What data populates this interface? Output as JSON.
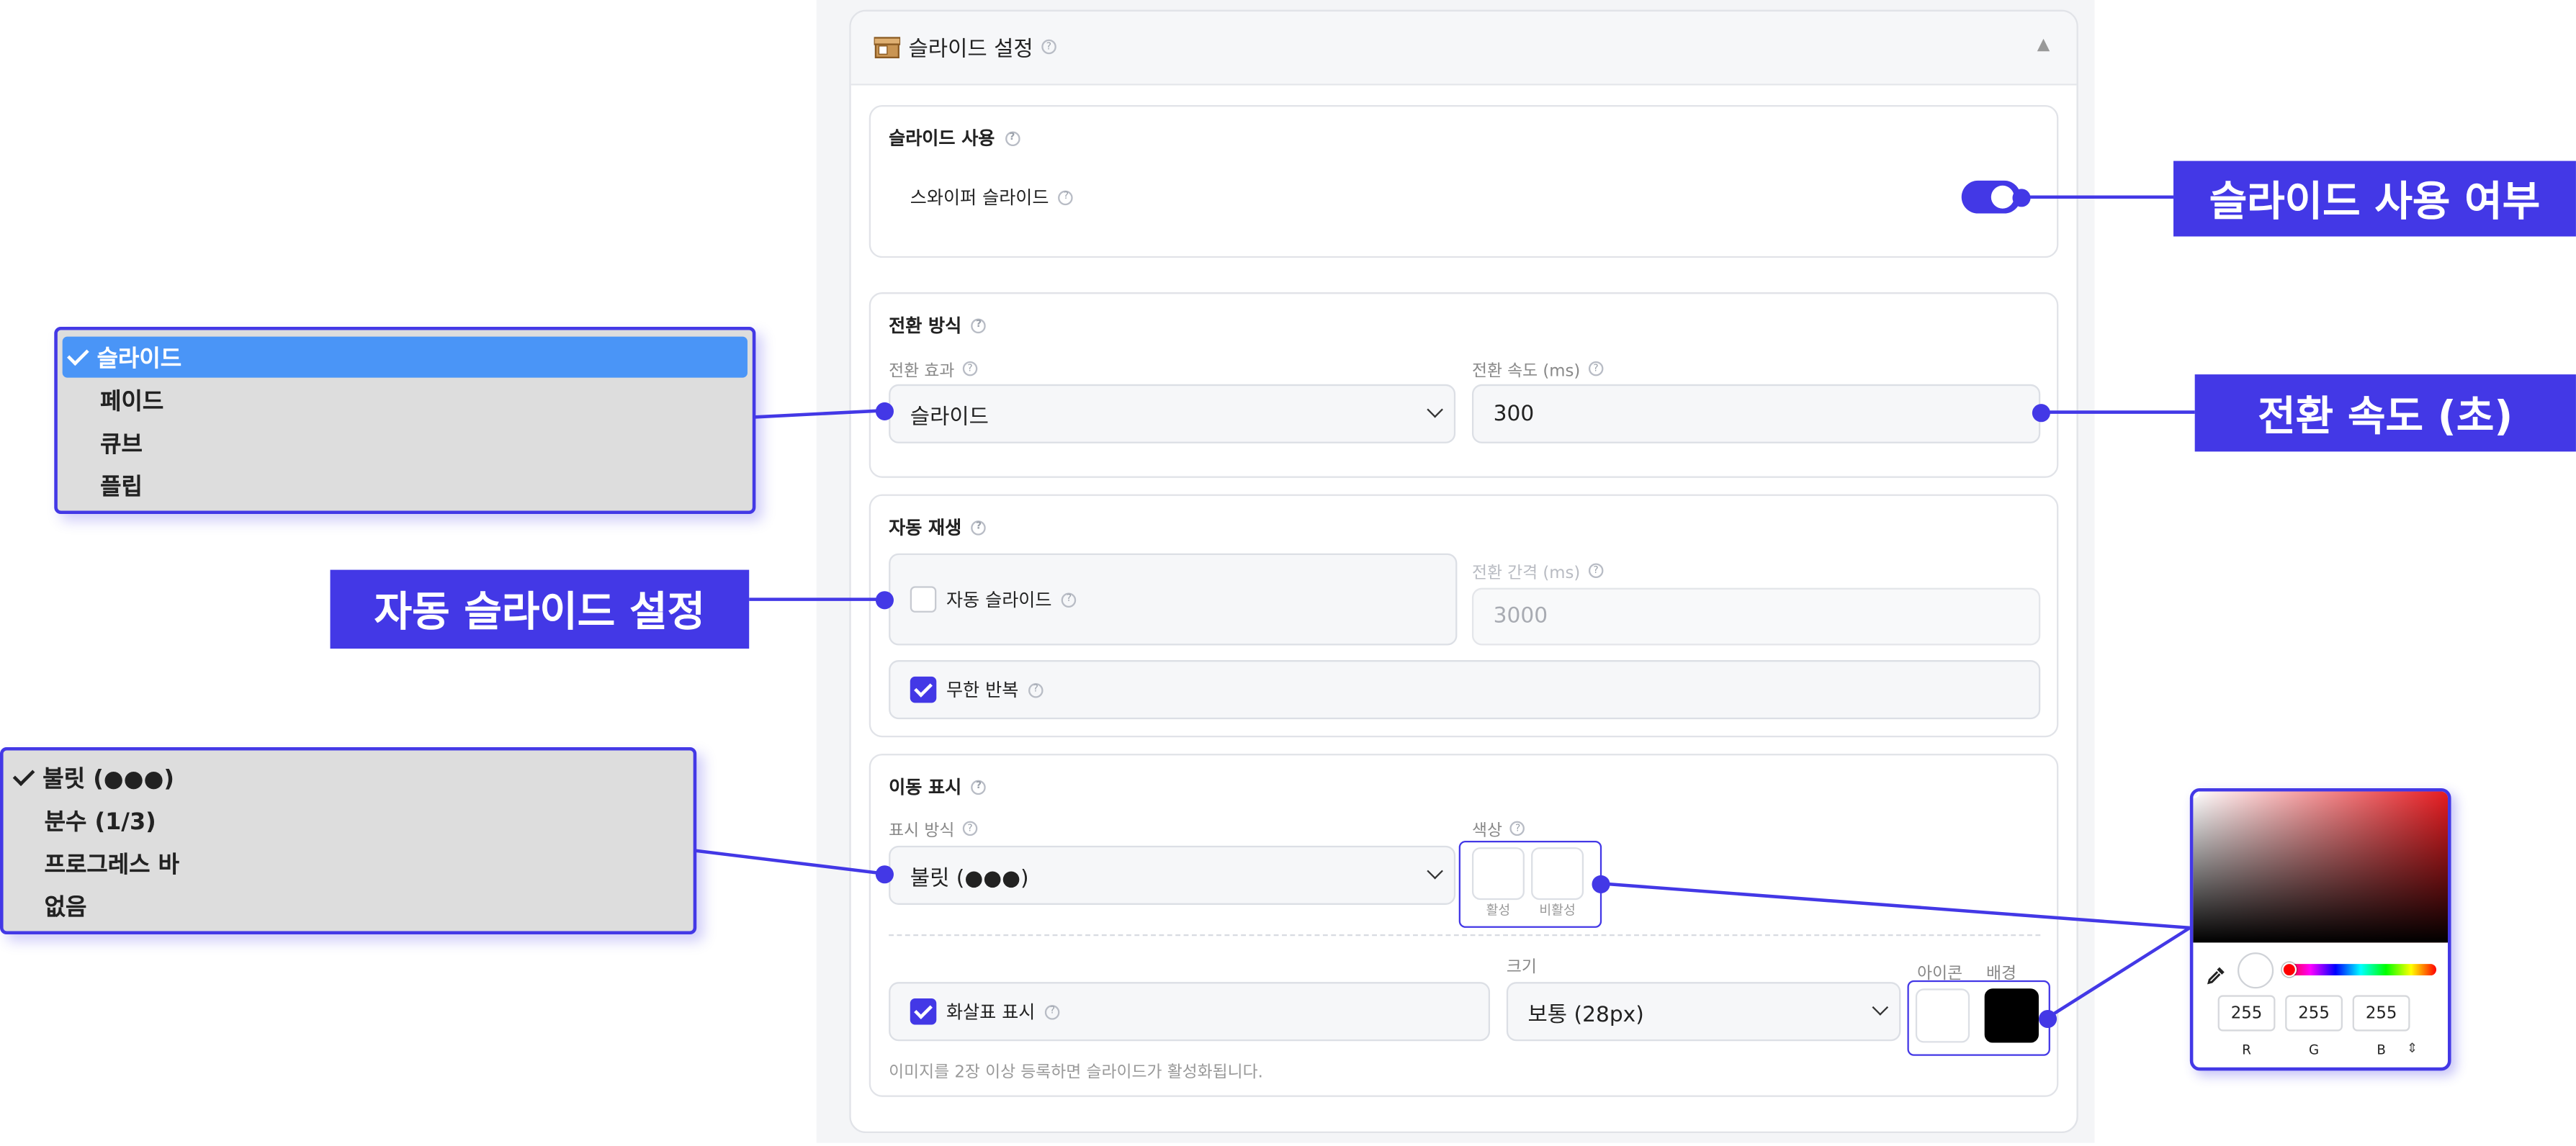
{
  "panel": {
    "title": "슬라이드 설정",
    "collapse_glyph": "▲",
    "icon": "box-icon"
  },
  "slide_use": {
    "title": "슬라이드 사용",
    "row_label": "스와이퍼 슬라이드",
    "toggle_on": true
  },
  "transition": {
    "title": "전환 방식",
    "effect_label": "전환 효과",
    "effect_value": "슬라이드",
    "speed_label": "전환 속도 (ms)",
    "speed_value": "300"
  },
  "autoplay": {
    "title": "자동 재생",
    "auto_label": "자동 슬라이드",
    "auto_checked": false,
    "interval_label": "전환 간격 (ms)",
    "interval_value": "3000",
    "loop_label": "무한 반복",
    "loop_checked": true
  },
  "navigation": {
    "title": "이동 표시",
    "mode_label": "표시 방식",
    "mode_value": "불릿 (●●●)",
    "color_label": "색상",
    "active_label": "활성",
    "inactive_label": "비활성",
    "arrow_label": "화살표 표시",
    "arrow_checked": true,
    "size_label": "크기",
    "size_value": "보통 (28px)",
    "icon_label": "아이콘",
    "bg_label": "배경",
    "icon_color": "#ffffff",
    "bg_color": "#000000",
    "hint": "이미지를 2장 이상 등록하면 슬라이드가 활성화됩니다."
  },
  "callouts": {
    "slide_use": "슬라이드 사용 여부",
    "speed": "전환 속도 (초)",
    "autoplay": "자동 슬라이드 설정"
  },
  "effect_menu": {
    "options": [
      "슬라이드",
      "페이드",
      "큐브",
      "플립"
    ],
    "selected_index": 0
  },
  "nav_menu": {
    "options": [
      "불릿 (●●●)",
      "분수 (1/3)",
      "프로그레스 바",
      "없음"
    ],
    "selected_index": 0
  },
  "color_picker": {
    "r": "255",
    "g": "255",
    "b": "255",
    "r_label": "R",
    "g_label": "G",
    "b_label": "B",
    "mode_glyph": "⇕",
    "eyedropper_icon": "eyedropper-icon"
  },
  "colors": {
    "accent": "#4338e6",
    "selected": "#4a95f7",
    "menu_bg": "#dddddd"
  }
}
